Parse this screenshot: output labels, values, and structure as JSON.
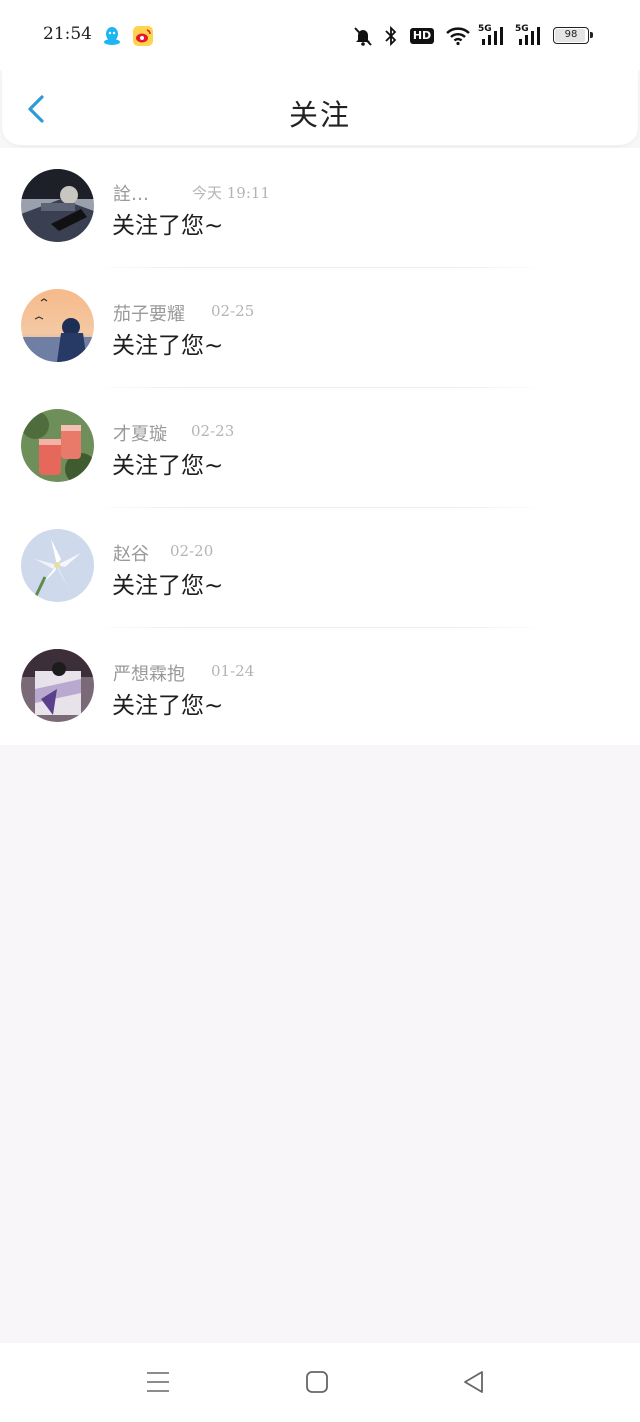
{
  "status_bar": {
    "time": "21:54",
    "app_icons": [
      "qq-icon",
      "weibo-icon"
    ],
    "system_icons": [
      "mute-icon",
      "bluetooth-icon",
      "hd-icon",
      "wifi-icon",
      "5g-signal-icon",
      "5g-signal-icon"
    ],
    "hd_label": "HD",
    "network_label": "5G",
    "battery_level": "98"
  },
  "header": {
    "back_icon": "back-chevron-icon",
    "title": "关注"
  },
  "colors": {
    "accent": "#2d9bd8",
    "background": "#f8f6f8",
    "name_gray": "#9a9a9a",
    "time_gray": "#b4b4b4"
  },
  "follows": [
    {
      "name": "詮…",
      "time": "今天 19:11",
      "message": "关注了您~"
    },
    {
      "name": "茄子要耀",
      "time": "02-25",
      "message": "关注了您~"
    },
    {
      "name": "才夏璇",
      "time": "02-23",
      "message": "关注了您~"
    },
    {
      "name": "赵谷",
      "time": "02-20",
      "message": "关注了您~"
    },
    {
      "name": "严想霖抱",
      "time": "01-24",
      "message": "关注了您~"
    }
  ],
  "nav_bar": {
    "buttons": [
      "menu-icon",
      "home-square-icon",
      "back-triangle-icon"
    ]
  }
}
